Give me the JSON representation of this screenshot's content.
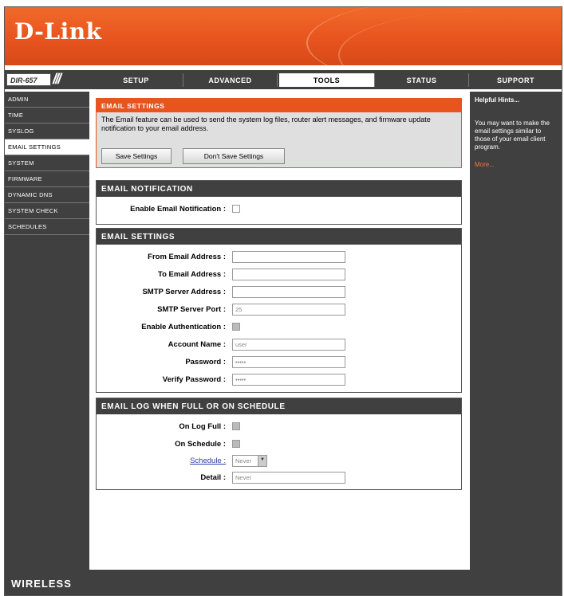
{
  "brand": {
    "logo": "D-Link",
    "model": "DIR-657",
    "footer": "WIRELESS",
    "accent": "#e8541e"
  },
  "tabs": [
    "SETUP",
    "ADVANCED",
    "TOOLS",
    "STATUS",
    "SUPPORT"
  ],
  "active_tab": "TOOLS",
  "sidebar": {
    "items": [
      "ADMIN",
      "TIME",
      "SYSLOG",
      "EMAIL SETTINGS",
      "SYSTEM",
      "FIRMWARE",
      "DYNAMIC DNS",
      "SYSTEM CHECK",
      "SCHEDULES"
    ],
    "active": "EMAIL SETTINGS"
  },
  "help": {
    "title": "Helpful Hints...",
    "text": "You may want to make the email settings similar to those of your email client program.",
    "more": "More..."
  },
  "intro": {
    "title": "EMAIL SETTINGS",
    "description": "The Email feature can be used to send the system log files, router alert messages, and firmware update notification to your email address.",
    "save_label": "Save Settings",
    "dont_save_label": "Don't Save Settings"
  },
  "notification": {
    "title": "EMAIL NOTIFICATION",
    "enable_label": "Enable Email Notification :",
    "enable_checked": false
  },
  "settings": {
    "title": "EMAIL SETTINGS",
    "from_label": "From Email Address :",
    "from_value": "",
    "to_label": "To Email Address :",
    "to_value": "",
    "smtp_addr_label": "SMTP Server Address :",
    "smtp_addr_value": "",
    "smtp_port_label": "SMTP Server Port :",
    "smtp_port_value": "25",
    "auth_label": "Enable Authentication :",
    "auth_checked": true,
    "account_label": "Account Name :",
    "account_value": "user",
    "password_label": "Password :",
    "password_value": "•••••",
    "verify_label": "Verify Password :",
    "verify_value": "•••••"
  },
  "schedule": {
    "title": "EMAIL LOG WHEN FULL OR ON SCHEDULE",
    "log_full_label": "On Log Full :",
    "log_full_checked": true,
    "on_schedule_label": "On Schedule :",
    "on_schedule_checked": true,
    "schedule_label": "Schedule :",
    "schedule_value": "Never",
    "detail_label": "Detail :",
    "detail_value": "Never"
  }
}
